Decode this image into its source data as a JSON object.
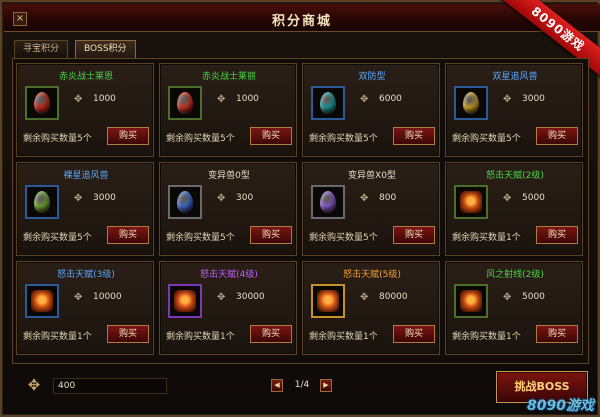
{
  "window": {
    "title": "积分商城",
    "close_label": "×",
    "ribbon": "8090游戏"
  },
  "tabs": [
    {
      "label": "寻宝积分",
      "active": false
    },
    {
      "label": "BOSS积分",
      "active": true
    }
  ],
  "buy_label": "购买",
  "price_icon": "point-emblem-icon",
  "items": [
    {
      "name": "赤炎战士莱恩",
      "name_color": "#48d848",
      "icon": "red-egg-icon",
      "color": "#c82a1a",
      "frame": "#4b6e2a",
      "price": "1000",
      "remaining": "剩余购买数量5个"
    },
    {
      "name": "赤炎战士莱丽",
      "name_color": "#48d848",
      "icon": "red-egg-icon",
      "color": "#d03020",
      "frame": "#4b6e2a",
      "price": "1000",
      "remaining": "剩余购买数量5个"
    },
    {
      "name": "双防型",
      "name_color": "#5aa8ff",
      "icon": "teal-egg-icon",
      "color": "#1a9a9a",
      "frame": "#2a5a9a",
      "price": "6000",
      "remaining": "剩余购买数量5个"
    },
    {
      "name": "双星追风兽",
      "name_color": "#5aa8ff",
      "icon": "gold-egg-icon",
      "color": "#c8a020",
      "frame": "#2a5a9a",
      "price": "3000",
      "remaining": "剩余购买数量5个"
    },
    {
      "name": "裸星追风兽",
      "name_color": "#5aa8ff",
      "icon": "green-egg-icon",
      "color": "#6aa830",
      "frame": "#2a5a9a",
      "price": "3000",
      "remaining": "剩余购买数量5个"
    },
    {
      "name": "变异兽0型",
      "name_color": "#e6dcc6",
      "icon": "blue-egg-icon",
      "color": "#3a6ad0",
      "frame": "#6a6a6a",
      "price": "300",
      "remaining": "剩余购买数量5个"
    },
    {
      "name": "变异兽X0型",
      "name_color": "#e6dcc6",
      "icon": "purple-egg-icon",
      "color": "#8a5ad0",
      "frame": "#6a6a6a",
      "price": "800",
      "remaining": "剩余购买数量5个"
    },
    {
      "name": "怒击天赋(2级)",
      "name_color": "#48d848",
      "icon": "rage-rune-icon",
      "color": "#c84a10",
      "frame": "#4b6e2a",
      "price": "5000",
      "remaining": "剩余购买数量1个"
    },
    {
      "name": "怒击天赋(3级)",
      "name_color": "#5aa8ff",
      "icon": "rage-rune-icon",
      "color": "#d05010",
      "frame": "#2a5a9a",
      "price": "10000",
      "remaining": "剩余购买数量1个"
    },
    {
      "name": "怒击天赋(4级)",
      "name_color": "#c060ff",
      "icon": "rage-rune-icon",
      "color": "#d04a18",
      "frame": "#7a3ab8",
      "price": "30000",
      "remaining": "剩余购买数量1个"
    },
    {
      "name": "怒击天赋(5级)",
      "name_color": "#f0a030",
      "icon": "rage-rune-icon",
      "color": "#d8581a",
      "frame": "#c8902a",
      "price": "80000",
      "remaining": "剩余购买数量1个"
    },
    {
      "name": "风之射线(2级)",
      "name_color": "#48d848",
      "icon": "wind-rune-icon",
      "color": "#c84a10",
      "frame": "#4b6e2a",
      "price": "5000",
      "remaining": "剩余购买数量1个"
    }
  ],
  "footer": {
    "points_icon": "point-emblem-icon",
    "points_value": "400",
    "prev_label": "◀",
    "next_label": "▶",
    "page": "1/4",
    "boss_button": "挑战BOSS",
    "watermark": "8090游戏"
  }
}
